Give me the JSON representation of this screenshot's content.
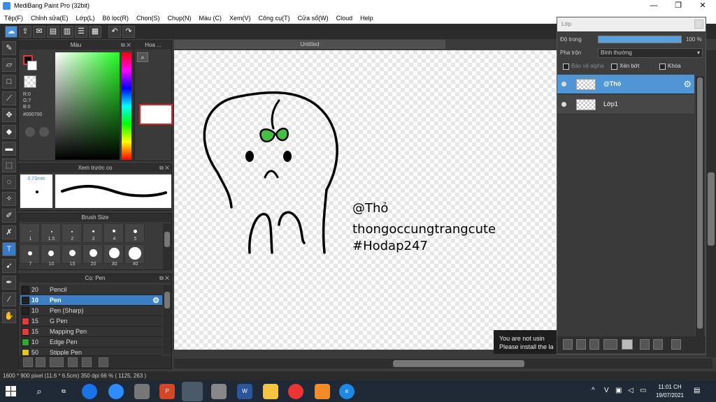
{
  "window": {
    "title": "MediBang Paint Pro (32bit)",
    "min": "—",
    "max": "❐",
    "close": "✕"
  },
  "menu": [
    "Tệp(F)",
    "Chỉnh sửa(E)",
    "Lớp(L)",
    "Bộ lọc(R)",
    "Chọn(S)",
    "Chụp(N)",
    "Màu (C)",
    "Xem(V)",
    "Công cụ(T)",
    "Cửa sổ(W)",
    "Cloud",
    "Help"
  ],
  "color_panel": {
    "title": "Màu",
    "r": "R:0",
    "g": "G:7",
    "b": "B:0",
    "hex": "#000700"
  },
  "navigator_panel": {
    "title": "Hoa ..."
  },
  "preview_panel": {
    "title": "Xem trước cọ",
    "size": "0.73mm"
  },
  "brush_size_panel": {
    "title": "Brush Size",
    "row1": [
      "1",
      "1.5",
      "2",
      "3",
      "4",
      "5"
    ],
    "row2": [
      "7",
      "10",
      "15",
      "20",
      "30",
      "40"
    ]
  },
  "brush_panel": {
    "title": "Cọ: Pen",
    "items": [
      {
        "num": "20",
        "name": "Pencil",
        "color": "#222222"
      },
      {
        "num": "10",
        "name": "Pen",
        "color": "#222222"
      },
      {
        "num": "10",
        "name": "Pen (Sharp)",
        "color": "#222222"
      },
      {
        "num": "15",
        "name": "G Pen",
        "color": "#e23c3c"
      },
      {
        "num": "15",
        "name": "Mapping Pen",
        "color": "#e23c3c"
      },
      {
        "num": "10",
        "name": "Edge Pen",
        "color": "#2eaa2e"
      },
      {
        "num": "50",
        "name": "Stipple Pen",
        "color": "#e6c619"
      }
    ]
  },
  "canvas": {
    "tab": "Untitled",
    "text_lines": [
      "@Thỏ",
      "thongoccungtrangcute",
      "#Hodap247"
    ]
  },
  "layers": {
    "title": "Lớp",
    "opacity_label": "Độ trong",
    "opacity_value": "100 %",
    "opacity": 100,
    "blend_label": "Pha trộn",
    "blend_value": "Bình thường",
    "protect_alpha": "Bảo vệ alpha",
    "clipping": "Xén bớt",
    "lock": "Khóa",
    "items": [
      {
        "name": "@Thỏ",
        "selected": true
      },
      {
        "name": "Lớp1",
        "selected": false
      }
    ]
  },
  "notice": {
    "line1": "You are not usin",
    "line2": "Please install the la"
  },
  "status": "1600 * 900 pixel  (11.6 * 6.5cm)  350 dpi  66 %  ( 1125, 263 )",
  "taskbar": {
    "time": "11:01 CH",
    "date": "19/07/2021",
    "lang": "V"
  }
}
